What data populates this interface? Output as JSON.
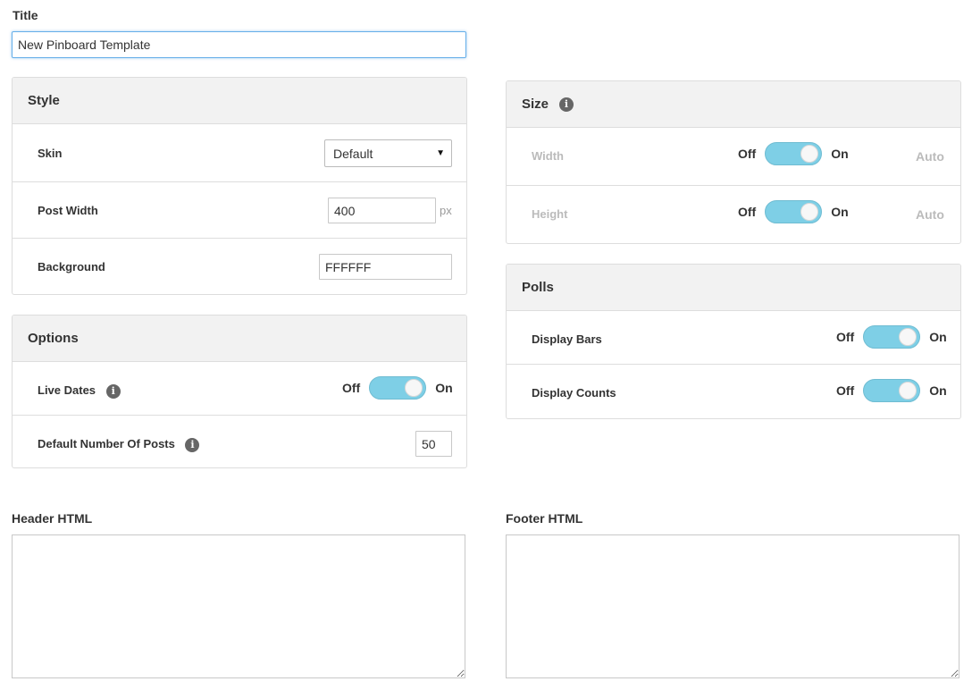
{
  "title": {
    "label": "Title",
    "value": "New Pinboard Template"
  },
  "style": {
    "heading": "Style",
    "skin": {
      "label": "Skin",
      "selected": "Default"
    },
    "post_width": {
      "label": "Post Width",
      "value": "400",
      "unit": "px"
    },
    "background": {
      "label": "Background",
      "value": "FFFFFF"
    }
  },
  "options": {
    "heading": "Options",
    "live_dates": {
      "label": "Live Dates",
      "off": "Off",
      "on": "On"
    },
    "default_posts": {
      "label": "Default Number Of Posts",
      "value": "50"
    }
  },
  "size": {
    "heading": "Size",
    "width": {
      "label": "Width",
      "off": "Off",
      "on": "On",
      "auto": "Auto"
    },
    "height": {
      "label": "Height",
      "off": "Off",
      "on": "On",
      "auto": "Auto"
    }
  },
  "polls": {
    "heading": "Polls",
    "display_bars": {
      "label": "Display Bars",
      "off": "Off",
      "on": "On"
    },
    "display_counts": {
      "label": "Display Counts",
      "off": "Off",
      "on": "On"
    }
  },
  "header_html": {
    "label": "Header HTML"
  },
  "footer_html": {
    "label": "Footer HTML"
  },
  "icons": {
    "info": "info-icon"
  },
  "colors": {
    "toggle_on": "#7ecfe6",
    "focus_border": "#66afe9"
  }
}
